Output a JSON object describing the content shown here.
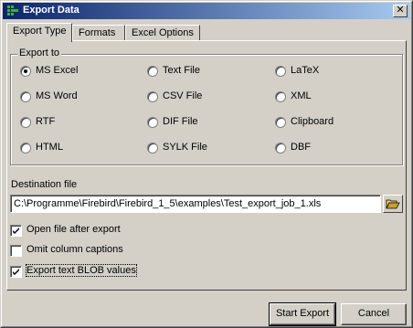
{
  "window": {
    "title": "Export Data",
    "close_glyph": "✕"
  },
  "tabs": [
    {
      "label": "Export Type",
      "underline": "E",
      "active": true
    },
    {
      "label": "Formats",
      "underline": "F",
      "active": false
    },
    {
      "label": "Excel Options",
      "underline": "E",
      "active": false
    }
  ],
  "export_to": {
    "legend": "Export to",
    "options": [
      {
        "label": "MS Excel",
        "checked": true
      },
      {
        "label": "Text File",
        "checked": false
      },
      {
        "label": "LaTeX",
        "checked": false
      },
      {
        "label": "MS Word",
        "checked": false
      },
      {
        "label": "CSV File",
        "checked": false
      },
      {
        "label": "XML",
        "checked": false
      },
      {
        "label": "RTF",
        "checked": false
      },
      {
        "label": "DIF File",
        "checked": false
      },
      {
        "label": "Clipboard",
        "checked": false
      },
      {
        "label": "HTML",
        "checked": false
      },
      {
        "label": "SYLK File",
        "checked": false
      },
      {
        "label": "DBF",
        "checked": false
      }
    ]
  },
  "destination": {
    "label": "Destination file",
    "value": "C:\\Programme\\Firebird\\Firebird_1_5\\examples\\Test_export_job_1.xls",
    "browse_icon": "folder-open-icon"
  },
  "options": [
    {
      "label": "Open file after export",
      "checked": true
    },
    {
      "label": "Omit column captions",
      "checked": false
    },
    {
      "label": "Export text BLOB values",
      "checked": true
    }
  ],
  "buttons": {
    "start": "Start Export",
    "cancel": "Cancel"
  }
}
